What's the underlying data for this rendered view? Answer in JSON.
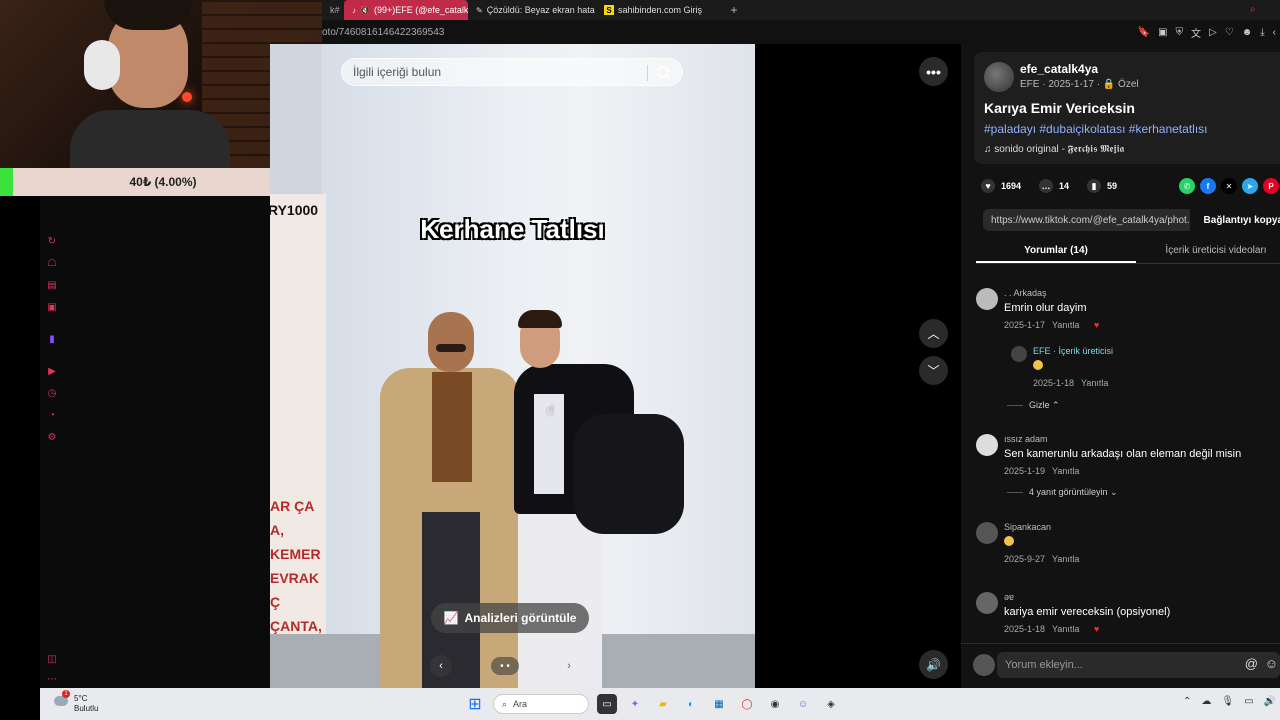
{
  "browser": {
    "tabs": [
      {
        "label": "k#"
      },
      {
        "label": "(99+)EFE (@efe_catalk",
        "active": true
      },
      {
        "label": "Çözüldü: Beyaz ekran hata"
      },
      {
        "label": "sahibinden.com Giriş"
      }
    ],
    "new_tab": "+",
    "url": "oto/7460816146422369543"
  },
  "overlay": {
    "donation_text": "40₺ (4.00%)",
    "donation_percent": 4.0
  },
  "video": {
    "search_placeholder": "İlgili içeriği bulun",
    "caption": "Kerhane Tatlısı",
    "banner_year": "RY1000",
    "banner_text": "AR ÇA\nÇANTA, KEMER\nEVRAK Ç\nÇANTA,\nNTASI Ç\nKAT M\nAR Ç",
    "analyze_label": "Analizleri görüntüle",
    "more_label": "•••",
    "dots": "• •"
  },
  "post": {
    "username": "efe_catalk4ya",
    "meta": "EFE · 2025-1-17 · 🔒 Özel",
    "title": "Karıya Emir Vericeksin",
    "tags": "#paladayı #dubaiçikolatası #kerhanetatlısı",
    "music": "♫  sonido original - 𝕱𝖊𝖗𝖈𝖍𝖎𝖘 𝕸𝖊𝖏𝖎𝖆",
    "likes": "1694",
    "comments": "14",
    "saves": "59",
    "link": "https://www.tiktok.com/@efe_catalk4ya/phot...",
    "copy_label": "Bağlantıyı kopya",
    "tab_comments": "Yorumlar (14)",
    "tab_creator": "İçerik üreticisi videoları"
  },
  "comments": [
    {
      "name": ". . Arkadaş",
      "text": "Emrin olur dayim",
      "date": "2025-1-17",
      "reply": "Yanıtla"
    },
    {
      "name": "EFE · İçerik üreticisi",
      "text": "",
      "date": "2025-1-18",
      "reply": "Yanıtla"
    },
    {
      "name": "ıssız adam",
      "text": "Sen kamerunlu arkadaşı olan eleman değil misin",
      "date": "2025-1-19",
      "reply": "Yanıtla"
    },
    {
      "name": "Sipankacan",
      "text": "",
      "date": "2025-9-27",
      "reply": "Yanıtla"
    },
    {
      "name": "ǝɐ",
      "text": "kariya emir vereceksin (opsiyonel)",
      "date": "2025-1-18",
      "reply": "Yanıtla"
    }
  ],
  "hide_label": "Gizle ⌃",
  "view_replies": "4 yanıt görüntüleyin ⌄",
  "comment_placeholder": "Yorum ekleyin...",
  "taskbar": {
    "weather_temp": "5°C",
    "weather_cond": "Bulutlu",
    "search": "Ara",
    "notif_count": "1"
  },
  "colors": {
    "accent": "#fe2c55",
    "tag": "#8fb2ff",
    "donation_fill": "#3ce23c"
  }
}
